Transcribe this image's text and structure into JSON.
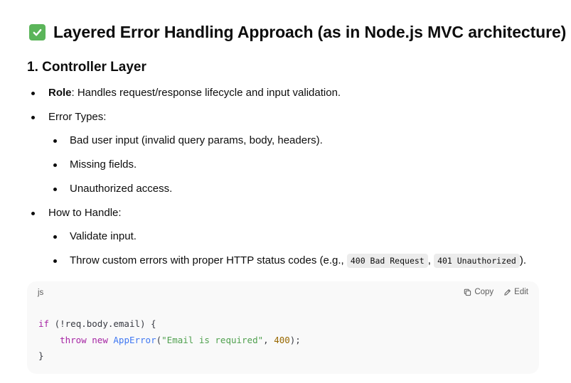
{
  "heading": {
    "icon": "check-mark-button-icon",
    "text": "Layered Error Handling Approach (as in Node.js MVC architecture)"
  },
  "section": {
    "title": "1. Controller Layer"
  },
  "role": {
    "label": "Role",
    "text": ": Handles request/response lifecycle and input validation."
  },
  "error_types": {
    "label": "Error Types:",
    "items": [
      "Bad user input (invalid query params, body, headers).",
      "Missing fields.",
      "Unauthorized access."
    ]
  },
  "how_to_handle": {
    "label": "How to Handle:",
    "items": [
      "Validate input.",
      {
        "prefix": "Throw custom errors with proper HTTP status codes (e.g., ",
        "code1": "400 Bad Request",
        "sep": ", ",
        "code2": "401 Unauthorized",
        "suffix": ")."
      }
    ]
  },
  "code_block": {
    "language": "js",
    "copy_label": "Copy",
    "edit_label": "Edit",
    "line1": {
      "kw": "if",
      "rest": " (!req.body.email) {"
    },
    "line2": {
      "indent": "    ",
      "kw1": "throw",
      "sp1": " ",
      "kw2": "new",
      "sp2": " ",
      "fn": "AppError",
      "p1": "(",
      "str": "\"Email is required\"",
      "comma": ", ",
      "num": "400",
      "end": ");"
    },
    "line3": "}",
    "colors": {
      "keyword": "#a626a4",
      "function": "#4078f2",
      "string": "#50a14f",
      "number": "#986801"
    }
  }
}
